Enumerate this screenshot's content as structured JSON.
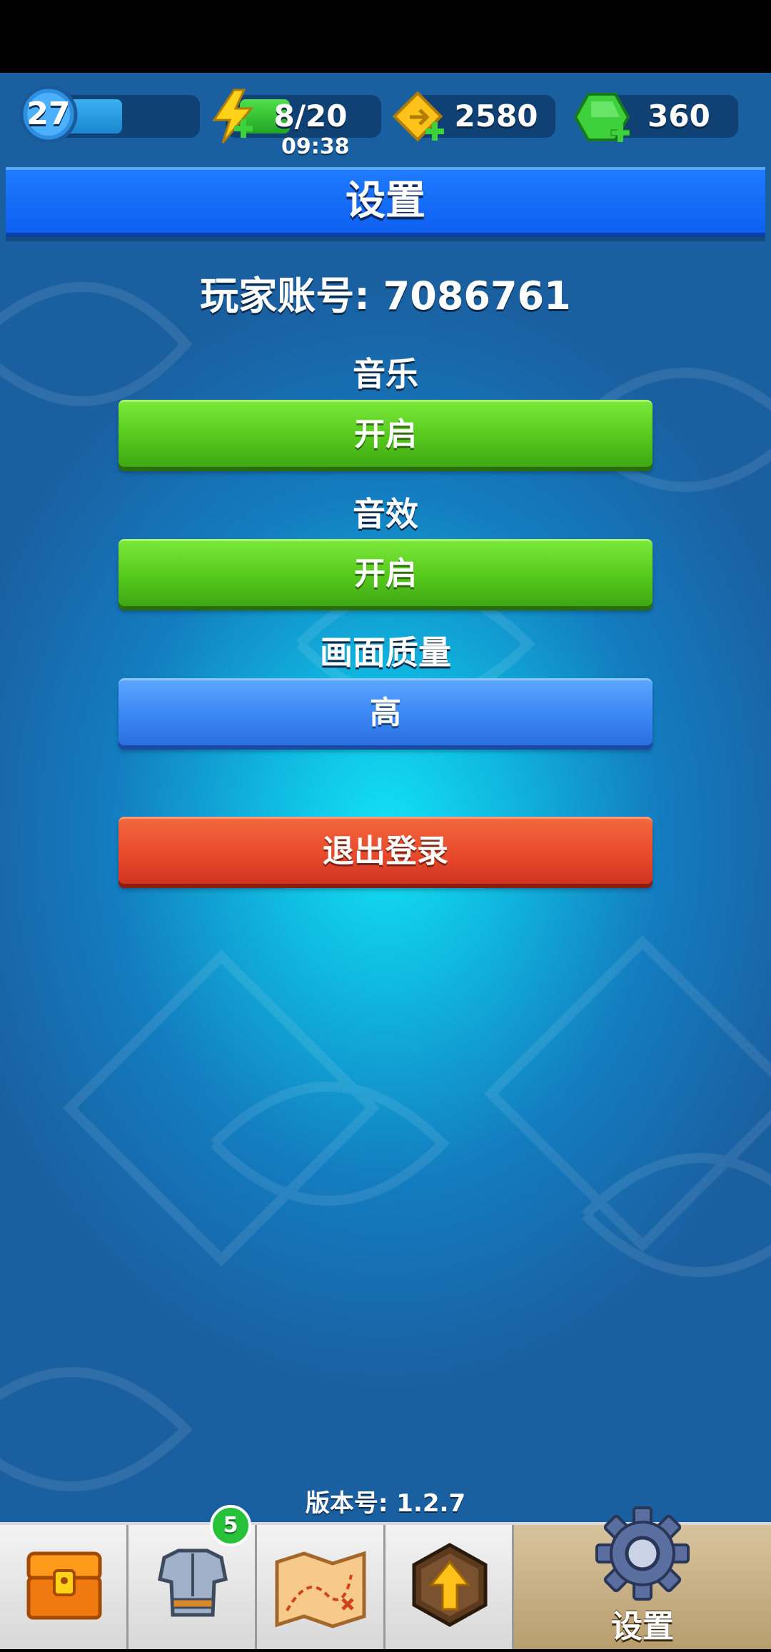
{
  "hud": {
    "level": "27",
    "level_progress": 0.47,
    "energy": "8/20",
    "energy_timer": "09:38",
    "coins": "2580",
    "gems": "360"
  },
  "title": "设置",
  "account": "玩家账号: 7086761",
  "settings": {
    "music_label": "音乐",
    "music_value": "开启",
    "sfx_label": "音效",
    "sfx_value": "开启",
    "quality_label": "画面质量",
    "quality_value": "高",
    "logout_label": "退出登录"
  },
  "version": "版本号: 1.2.7",
  "nav": {
    "items": [
      {
        "icon": "treasure-chest-icon"
      },
      {
        "icon": "armor-icon",
        "badge": "5"
      },
      {
        "icon": "treasure-map-icon"
      },
      {
        "icon": "upgrade-arrow-icon"
      },
      {
        "icon": "gear-icon",
        "label": "设置",
        "active": true
      }
    ]
  },
  "colors": {
    "title_bar": "#1f7bff",
    "button_on": "#55c81c",
    "button_quality": "#3a86f5",
    "button_logout": "#e84a2c"
  }
}
